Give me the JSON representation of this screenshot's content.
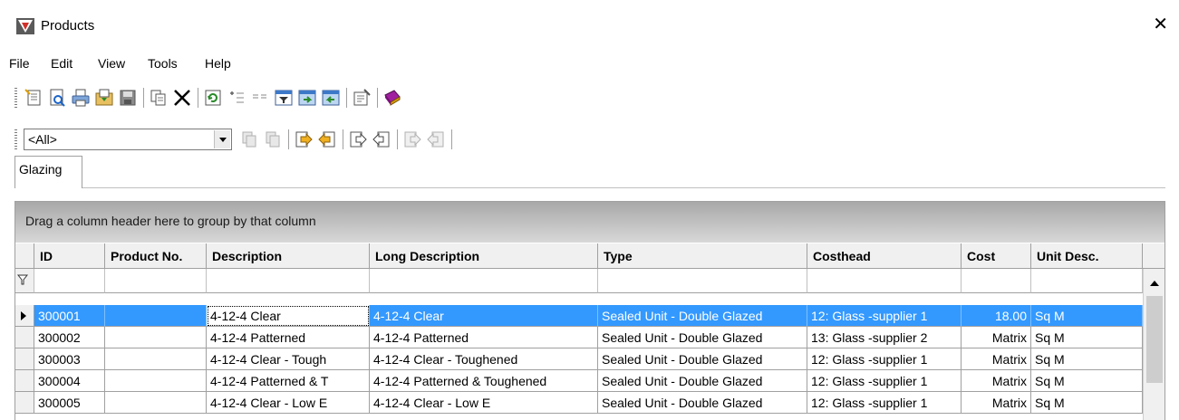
{
  "window": {
    "title": "Products",
    "close_icon": "close-icon",
    "app_icon": "app-icon"
  },
  "menu": [
    "File",
    "Edit",
    "View",
    "Tools",
    "Help"
  ],
  "toolbar1_icons": [
    "new-icon",
    "print-preview-icon",
    "print-icon",
    "export-icon",
    "save-icon",
    "copy-icon",
    "delete-icon",
    "refresh-icon",
    "add-field-icon",
    "fields-icon",
    "filter-icon",
    "import-icon",
    "export-data-icon",
    "properties-icon",
    "book-icon"
  ],
  "toolbar2": {
    "combo_value": "<All>",
    "icons": [
      "disabled-copy-icon",
      "disabled-paste-icon",
      "move-right-icon",
      "move-left-icon",
      "forward-icon",
      "back-icon",
      "disabled-forward-icon",
      "disabled-back-icon"
    ]
  },
  "tabs": [
    {
      "label": "Glazing"
    }
  ],
  "grid": {
    "group_hint": "Drag a column header here to group by that column",
    "columns": [
      "ID",
      "Product No.",
      "Description",
      "Long Description",
      "Type",
      "Costhead",
      "Cost",
      "Unit Desc."
    ],
    "rows": [
      {
        "id": "300001",
        "product_no": "",
        "description": "4-12-4 Clear",
        "long_description": "4-12-4 Clear",
        "type": "Sealed Unit - Double Glazed",
        "costhead": "12: Glass -supplier 1",
        "cost": "18.00",
        "unit": "Sq M",
        "selected": true
      },
      {
        "id": "300002",
        "product_no": "",
        "description": "4-12-4 Patterned",
        "long_description": "4-12-4 Patterned",
        "type": "Sealed Unit - Double Glazed",
        "costhead": "13: Glass -supplier 2",
        "cost": "Matrix",
        "unit": "Sq M"
      },
      {
        "id": "300003",
        "product_no": "",
        "description": "4-12-4 Clear - Tough",
        "long_description": "4-12-4 Clear - Toughened",
        "type": "Sealed Unit - Double Glazed",
        "costhead": "12: Glass -supplier 1",
        "cost": "Matrix",
        "unit": "Sq M"
      },
      {
        "id": "300004",
        "product_no": "",
        "description": "4-12-4 Patterned & T",
        "long_description": "4-12-4 Patterned & Toughened",
        "type": "Sealed Unit - Double Glazed",
        "costhead": "12: Glass -supplier 1",
        "cost": "Matrix",
        "unit": "Sq M"
      },
      {
        "id": "300005",
        "product_no": "",
        "description": "4-12-4 Clear - Low E",
        "long_description": "4-12-4 Clear - Low E",
        "type": "Sealed Unit - Double Glazed",
        "costhead": "12: Glass -supplier 1",
        "cost": "Matrix",
        "unit": "Sq M"
      }
    ]
  }
}
